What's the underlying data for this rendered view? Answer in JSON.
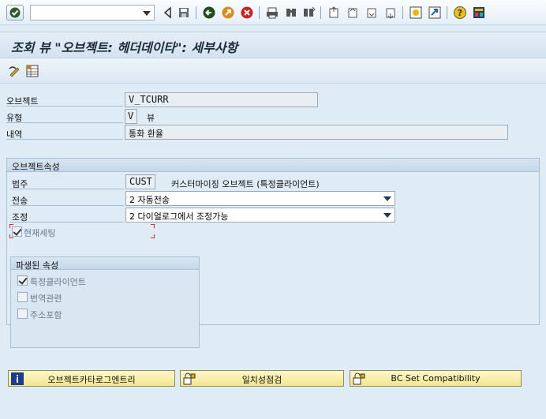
{
  "toolbar": {
    "command_field": "",
    "icons": [
      "enter-icon",
      "back-icon",
      "save-icon",
      "back-green-icon",
      "exit-icon",
      "cancel-icon",
      "print-icon",
      "find-icon",
      "find-next-icon",
      "first-page-icon",
      "prev-page-icon",
      "next-page-icon",
      "last-page-icon",
      "create-session-icon",
      "shortcut-icon",
      "help-icon",
      "layout-icon"
    ]
  },
  "title": "조회 뷰 \"오브젝트: 헤더데이타\": 세부사항",
  "header": {
    "object_label": "오브젝트",
    "object_value": "V_TCURR",
    "type_label": "유형",
    "type_value": "V",
    "type_desc": "뷰",
    "desc_label": "내역",
    "desc_value": "통화 환율"
  },
  "attributes": {
    "title": "오브젝트속성",
    "category_label": "범주",
    "category_value": "CUST",
    "category_desc": "커스터마이징 오브젝트 (특정클라이언트)",
    "transport_label": "전송",
    "transport_value": "2 자동전송",
    "adjust_label": "조정",
    "adjust_value": "2 다이얼로그에서 조정가능",
    "current_setting_label": "현재세팅",
    "current_setting_checked": true
  },
  "derived": {
    "title": "파생된 속성",
    "items": [
      {
        "label": "특정클라이언트",
        "checked": true
      },
      {
        "label": "번역관련",
        "checked": false
      },
      {
        "label": "주소포함",
        "checked": false
      }
    ]
  },
  "buttons": {
    "catalog": "오브젝트카타로그엔트리",
    "consistency": "일치성점검",
    "bcset": "BC Set Compatibility"
  },
  "colors": {
    "background": "#dfebf5",
    "button": "#f3e58f"
  }
}
